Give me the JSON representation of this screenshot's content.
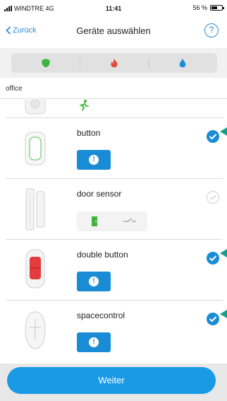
{
  "status_bar": {
    "carrier": "WINDTRE 4G",
    "time": "11:41",
    "battery": "56 %",
    "battery_level": 0.56
  },
  "nav": {
    "back_label": "Zurück",
    "title": "Geräte auswählen",
    "help_label": "?"
  },
  "filters": [
    {
      "icon": "shield-icon",
      "color": "#3db53d"
    },
    {
      "icon": "fire-icon",
      "color": "#e5473a"
    },
    {
      "icon": "water-drop-icon",
      "color": "#1a8cd6"
    }
  ],
  "room": {
    "name": "office"
  },
  "devices": [
    {
      "name": "",
      "kind": "partial-top",
      "icon": "running-man-icon",
      "icon_color": "#3db53d"
    },
    {
      "name": "button",
      "selected": true,
      "action": "alarm"
    },
    {
      "name": "door sensor",
      "selected": false,
      "action": "modes"
    },
    {
      "name": "double button",
      "selected": true,
      "action": "alarm"
    },
    {
      "name": "spacecontrol",
      "selected": true,
      "action": "alarm"
    }
  ],
  "footer": {
    "next_label": "Weiter"
  },
  "colors": {
    "accent": "#1a8cd6",
    "check": "#1a8cd6",
    "pointer": "#17a089",
    "button": "#1a9ae5"
  }
}
